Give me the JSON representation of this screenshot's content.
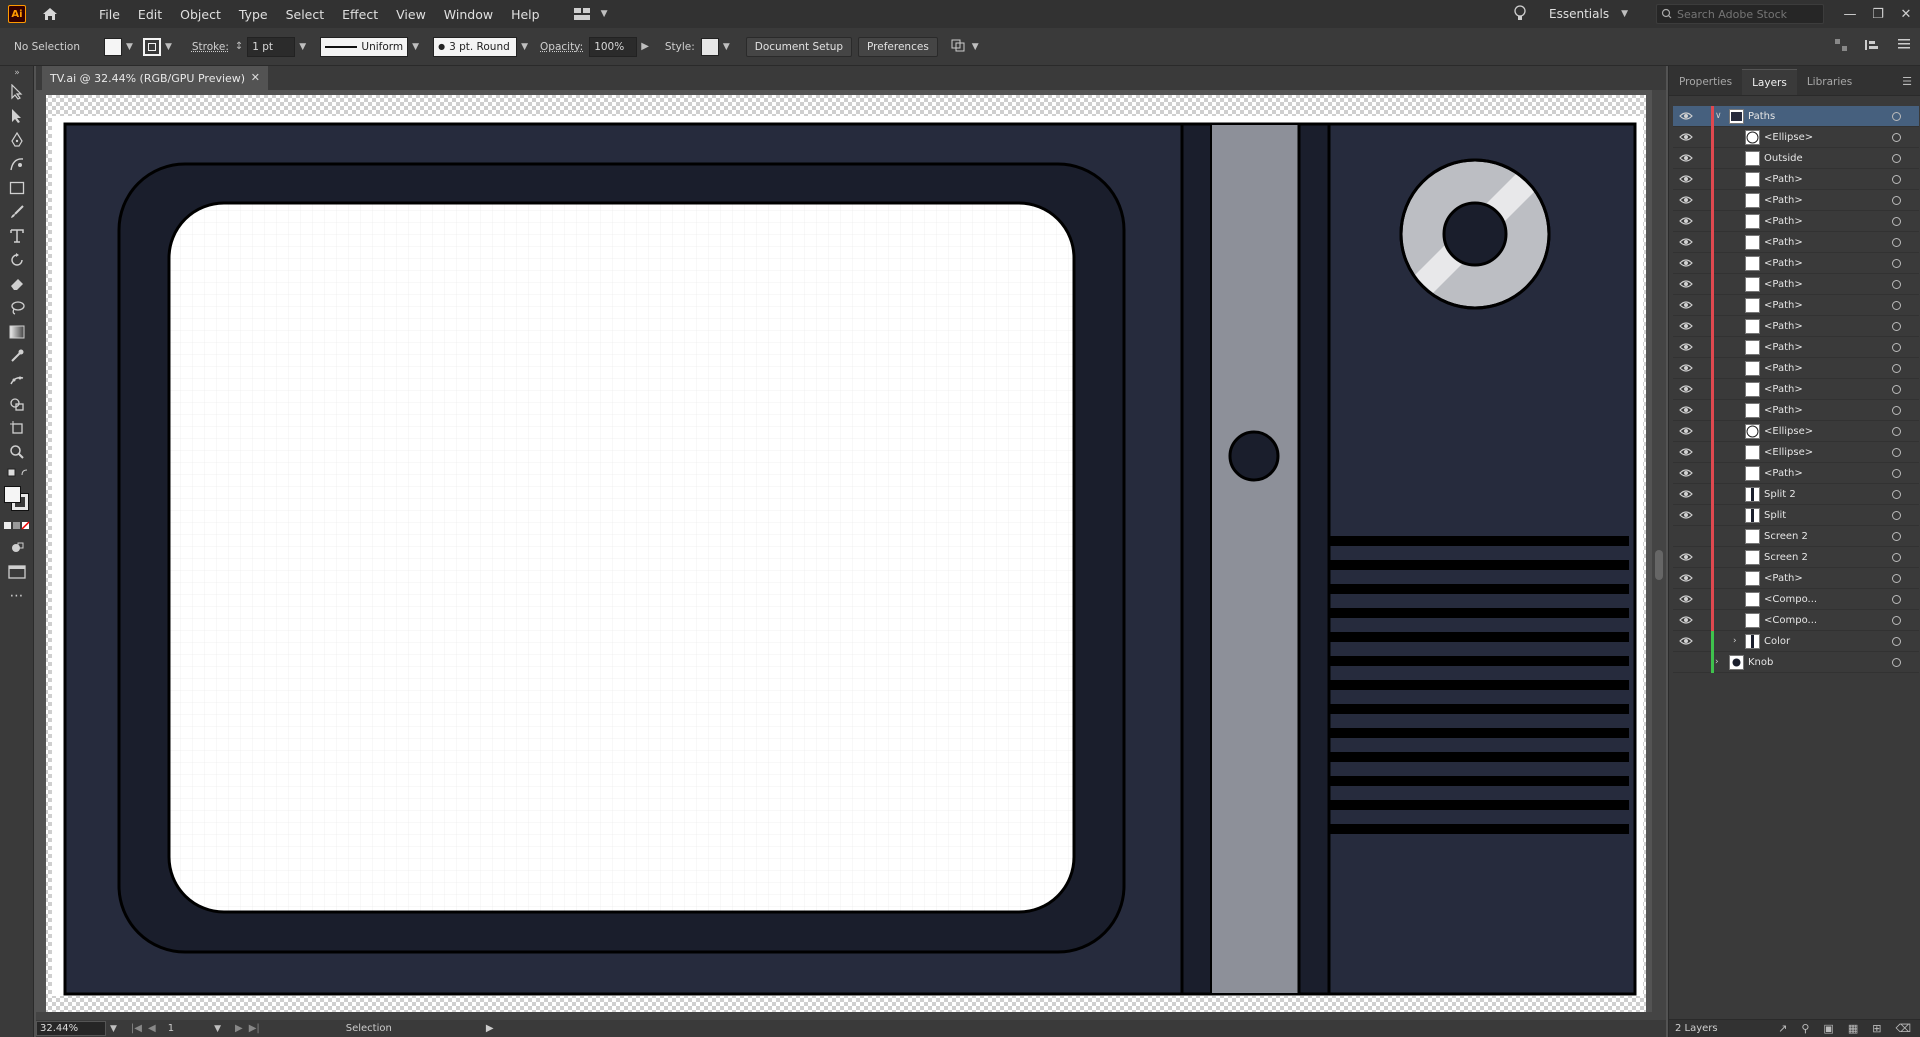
{
  "app": {
    "logo_text": "Ai",
    "menus": [
      "File",
      "Edit",
      "Object",
      "Type",
      "Select",
      "Effect",
      "View",
      "Window",
      "Help"
    ],
    "workspace": "Essentials",
    "stock_search_placeholder": "Search Adobe Stock"
  },
  "control_bar": {
    "selection_state": "No Selection",
    "stroke_label": "Stroke:",
    "stroke_weight": "1 pt",
    "stroke_profile": "Uniform",
    "brush": "3 pt. Round",
    "opacity_label": "Opacity:",
    "opacity_value": "100%",
    "style_label": "Style:",
    "document_setup": "Document Setup",
    "preferences": "Preferences"
  },
  "document": {
    "tab_title": "TV.ai @ 32.44% (RGB/GPU Preview)",
    "zoom": "32.44%",
    "artboard_number": "1",
    "status_tool": "Selection"
  },
  "colors": {
    "tv_body": "#262b3d",
    "tv_bezel": "#1a1e2c",
    "screen": "#ffffff",
    "strip": "#8d9099",
    "knob_ring": "#bcbec3",
    "knob_highlight": "#e8e8ea",
    "vent_dark": "#000000",
    "selection_row": "#46607e"
  },
  "panel": {
    "tabs": [
      "Properties",
      "Layers",
      "Libraries"
    ],
    "active_tab": "Layers",
    "layers_count": "2 Layers",
    "layers": [
      {
        "name": "Paths",
        "level": 0,
        "visible": true,
        "expanded": true,
        "selected": true,
        "thumb": "group"
      },
      {
        "name": "<Ellipse>",
        "level": 1,
        "visible": true,
        "thumb": "ellipse"
      },
      {
        "name": "Outside",
        "level": 1,
        "visible": true,
        "thumb": "rect"
      },
      {
        "name": "<Path>",
        "level": 1,
        "visible": true,
        "thumb": "rect"
      },
      {
        "name": "<Path>",
        "level": 1,
        "visible": true,
        "thumb": "rect"
      },
      {
        "name": "<Path>",
        "level": 1,
        "visible": true,
        "thumb": "rect"
      },
      {
        "name": "<Path>",
        "level": 1,
        "visible": true,
        "thumb": "rect"
      },
      {
        "name": "<Path>",
        "level": 1,
        "visible": true,
        "thumb": "rect"
      },
      {
        "name": "<Path>",
        "level": 1,
        "visible": true,
        "thumb": "rect"
      },
      {
        "name": "<Path>",
        "level": 1,
        "visible": true,
        "thumb": "rect"
      },
      {
        "name": "<Path>",
        "level": 1,
        "visible": true,
        "thumb": "rect"
      },
      {
        "name": "<Path>",
        "level": 1,
        "visible": true,
        "thumb": "rect"
      },
      {
        "name": "<Path>",
        "level": 1,
        "visible": true,
        "thumb": "rect"
      },
      {
        "name": "<Path>",
        "level": 1,
        "visible": true,
        "thumb": "rect"
      },
      {
        "name": "<Path>",
        "level": 1,
        "visible": true,
        "thumb": "rect"
      },
      {
        "name": "<Ellipse>",
        "level": 1,
        "visible": true,
        "thumb": "ellipse"
      },
      {
        "name": "<Ellipse>",
        "level": 1,
        "visible": true,
        "thumb": "rect"
      },
      {
        "name": "<Path>",
        "level": 1,
        "visible": true,
        "thumb": "rect"
      },
      {
        "name": "Split 2",
        "level": 1,
        "visible": true,
        "thumb": "split"
      },
      {
        "name": "Split",
        "level": 1,
        "visible": true,
        "thumb": "split"
      },
      {
        "name": "Screen 2",
        "level": 1,
        "visible": false,
        "thumb": "rect"
      },
      {
        "name": "Screen 2",
        "level": 1,
        "visible": true,
        "thumb": "rect"
      },
      {
        "name": "<Path>",
        "level": 1,
        "visible": true,
        "thumb": "rect"
      },
      {
        "name": "<Compo...",
        "level": 1,
        "visible": true,
        "thumb": "rect"
      },
      {
        "name": "<Compo...",
        "level": 1,
        "visible": true,
        "thumb": "rect"
      },
      {
        "name": "Color",
        "level": 1,
        "visible": true,
        "expanded": false,
        "thumb": "split"
      },
      {
        "name": "Knob",
        "level": 0,
        "visible": false,
        "expanded": false,
        "thumb": "knob"
      }
    ]
  }
}
